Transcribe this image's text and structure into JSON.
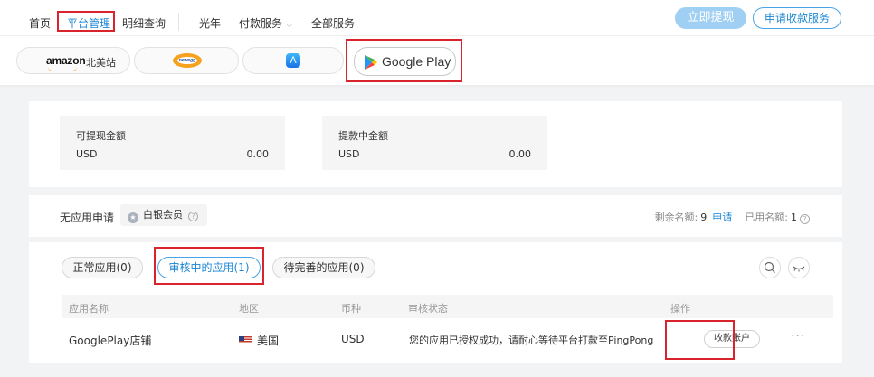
{
  "nav": {
    "home": "首页",
    "platform": "平台管理",
    "details": "明细查询",
    "lightyear": "光年",
    "payment": "付款服务",
    "all_services": "全部服务",
    "withdraw_button": "立即提现",
    "apply_button": "申请收款服务"
  },
  "platforms": {
    "amazon_logo": "amazon",
    "amazon_region": "北美站",
    "newegg_logo": "newegg",
    "apple_icon": "app-store-icon",
    "google": "Google Play"
  },
  "balances": {
    "withdrawable_title": "可提现金额",
    "withdrawable_currency": "USD",
    "withdrawable_value": "0.00",
    "withdrawing_title": "提款中金额",
    "withdrawing_currency": "USD",
    "withdrawing_value": "0.00"
  },
  "apply_summary": {
    "status": "无应用申请",
    "member_level": "白银会员",
    "remaining_label": "剩余名额:",
    "remaining_value": "9",
    "apply_link": "申请",
    "used_label": "已用名额:",
    "used_value": "1"
  },
  "filters": {
    "normal": "正常应用(0)",
    "reviewing": "审核中的应用(1)",
    "incomplete": "待完善的应用(0)"
  },
  "table": {
    "headers": [
      "应用名称",
      "地区",
      "币种",
      "审核状态",
      "操作"
    ],
    "rows": [
      {
        "name": "GooglePlay店铺",
        "region": "美国",
        "currency": "USD",
        "status": "您的应用已授权成功，请耐心等待平台打款至PingPong",
        "action": "收款账户",
        "more": "···"
      }
    ]
  },
  "colors": {
    "primary": "#1c86d4",
    "highlight_box": "#d9232d",
    "withdraw_button": "#9fcff2"
  }
}
